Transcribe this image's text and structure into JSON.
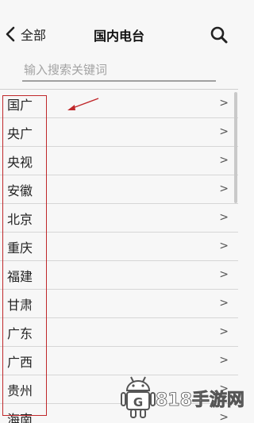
{
  "header": {
    "back_label": "全部",
    "title": "国内电台"
  },
  "search": {
    "placeholder": "输入搜索关键词",
    "value": ""
  },
  "list": {
    "chevron": ">",
    "items": [
      {
        "label": "国广"
      },
      {
        "label": "央广"
      },
      {
        "label": "央视"
      },
      {
        "label": "安徽"
      },
      {
        "label": "北京"
      },
      {
        "label": "重庆"
      },
      {
        "label": "福建"
      },
      {
        "label": "甘肃"
      },
      {
        "label": "广东"
      },
      {
        "label": "广西"
      },
      {
        "label": "贵州"
      },
      {
        "label": "海南"
      }
    ]
  },
  "annotation": {
    "box_color": "#c0282b",
    "arrow_color": "#c0282b"
  },
  "watermark": {
    "text": "818手游网",
    "logo_letter": "G"
  }
}
